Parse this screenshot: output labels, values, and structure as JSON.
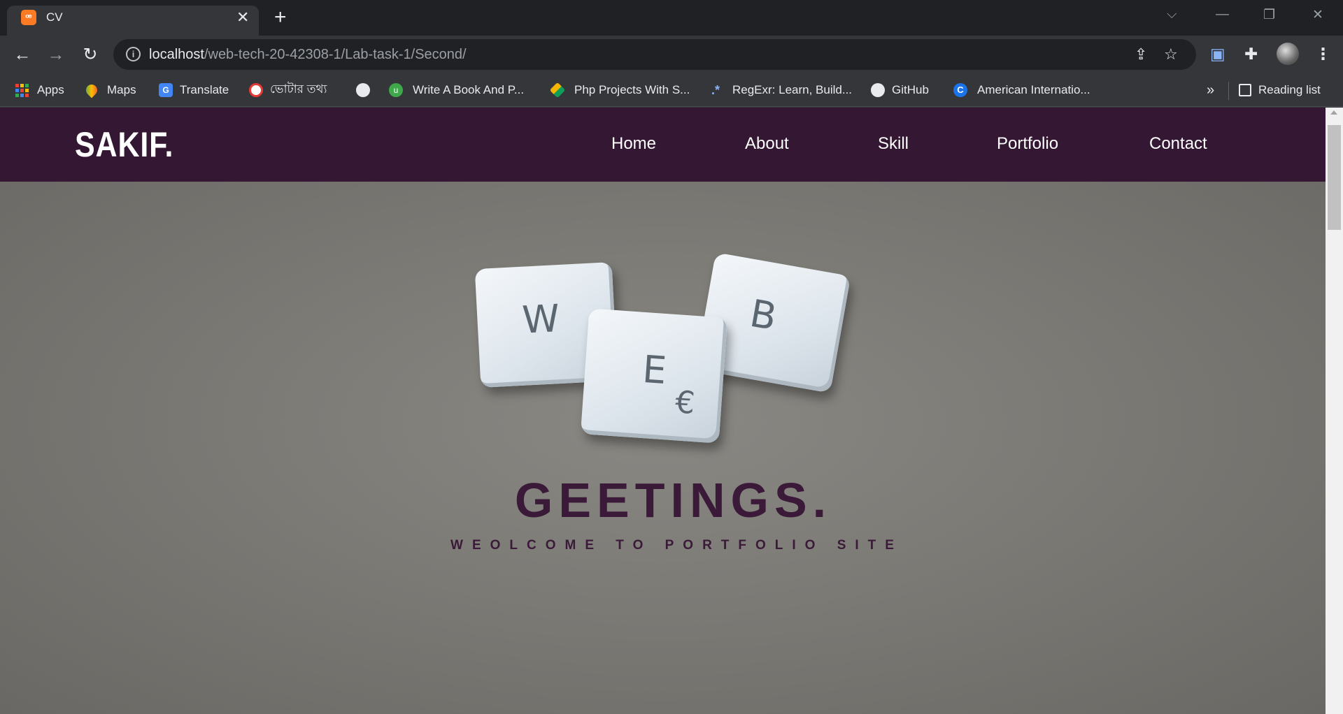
{
  "browser": {
    "tab_title": "CV",
    "tab_close": "✕",
    "new_tab": "+",
    "window_controls": {
      "tab_search": "⌵",
      "minimize": "—",
      "restore": "❐",
      "close": "✕"
    },
    "url_host": "localhost",
    "url_path": "/web-tech-20-42308-1/Lab-task-1/Second/",
    "nav": {
      "back": "←",
      "forward": "→",
      "reload": "↻"
    }
  },
  "bookmarks": {
    "items": [
      {
        "label": "Apps",
        "icon": "apps-grid-icon"
      },
      {
        "label": "Maps",
        "icon": "maps-pin-icon"
      },
      {
        "label": "Translate",
        "icon": "translate-icon"
      },
      {
        "label": "ভোটার তথ্য",
        "icon": "voter-info-icon"
      },
      {
        "label": "",
        "icon": "globe-icon"
      },
      {
        "label": "Write A Book And P...",
        "icon": "write-book-icon"
      },
      {
        "label": "Php Projects With S...",
        "icon": "php-projects-icon"
      },
      {
        "label": "RegExr: Learn, Build...",
        "icon": "regexr-icon"
      },
      {
        "label": "GitHub",
        "icon": "github-icon"
      },
      {
        "label": "American Internatio...",
        "icon": "aiub-icon"
      }
    ],
    "overflow": "»",
    "reading_list": "Reading list"
  },
  "site": {
    "logo": "SAKIF.",
    "nav": [
      "Home",
      "About",
      "Skill",
      "Portfolio",
      "Contact"
    ],
    "hero": {
      "tiles": [
        "W",
        "B",
        "E",
        "€"
      ],
      "headline": "GEETINGS.",
      "subline": "WEOLCOME TO PORTFOLIO SITE"
    }
  },
  "colors": {
    "header_bg": "#341733",
    "headline": "#3a1a38",
    "hero_bg": "#7d7b76",
    "tab_favicon": "#fb7a24"
  }
}
